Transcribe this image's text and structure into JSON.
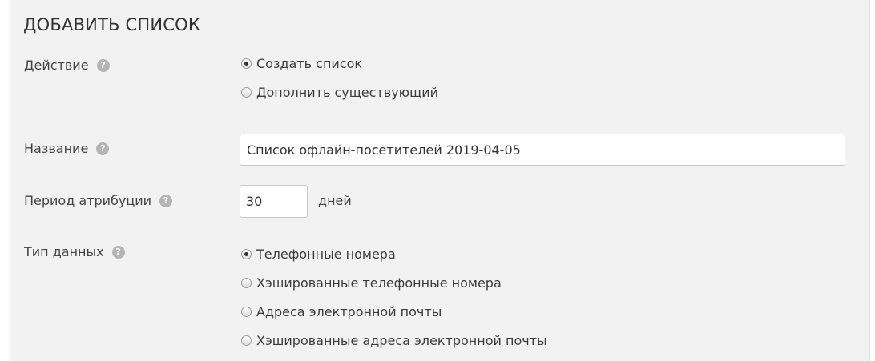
{
  "title": "ДОБАВИТЬ СПИСОК",
  "action": {
    "label": "Действие",
    "options": [
      "Создать список",
      "Дополнить существующий"
    ],
    "selected": 0
  },
  "name": {
    "label": "Название",
    "value": "Список офлайн-посетителей 2019-04-05"
  },
  "attribution": {
    "label": "Период атрибуции",
    "value": "30",
    "unit": "дней"
  },
  "data_type": {
    "label": "Тип данных",
    "options": [
      "Телефонные номера",
      "Хэшированные телефонные номера",
      "Адреса электронной почты",
      "Хэшированные адреса электронной почты"
    ],
    "selected": 0
  },
  "help_glyph": "?",
  "icons": {
    "help": "question-circle-icon"
  }
}
